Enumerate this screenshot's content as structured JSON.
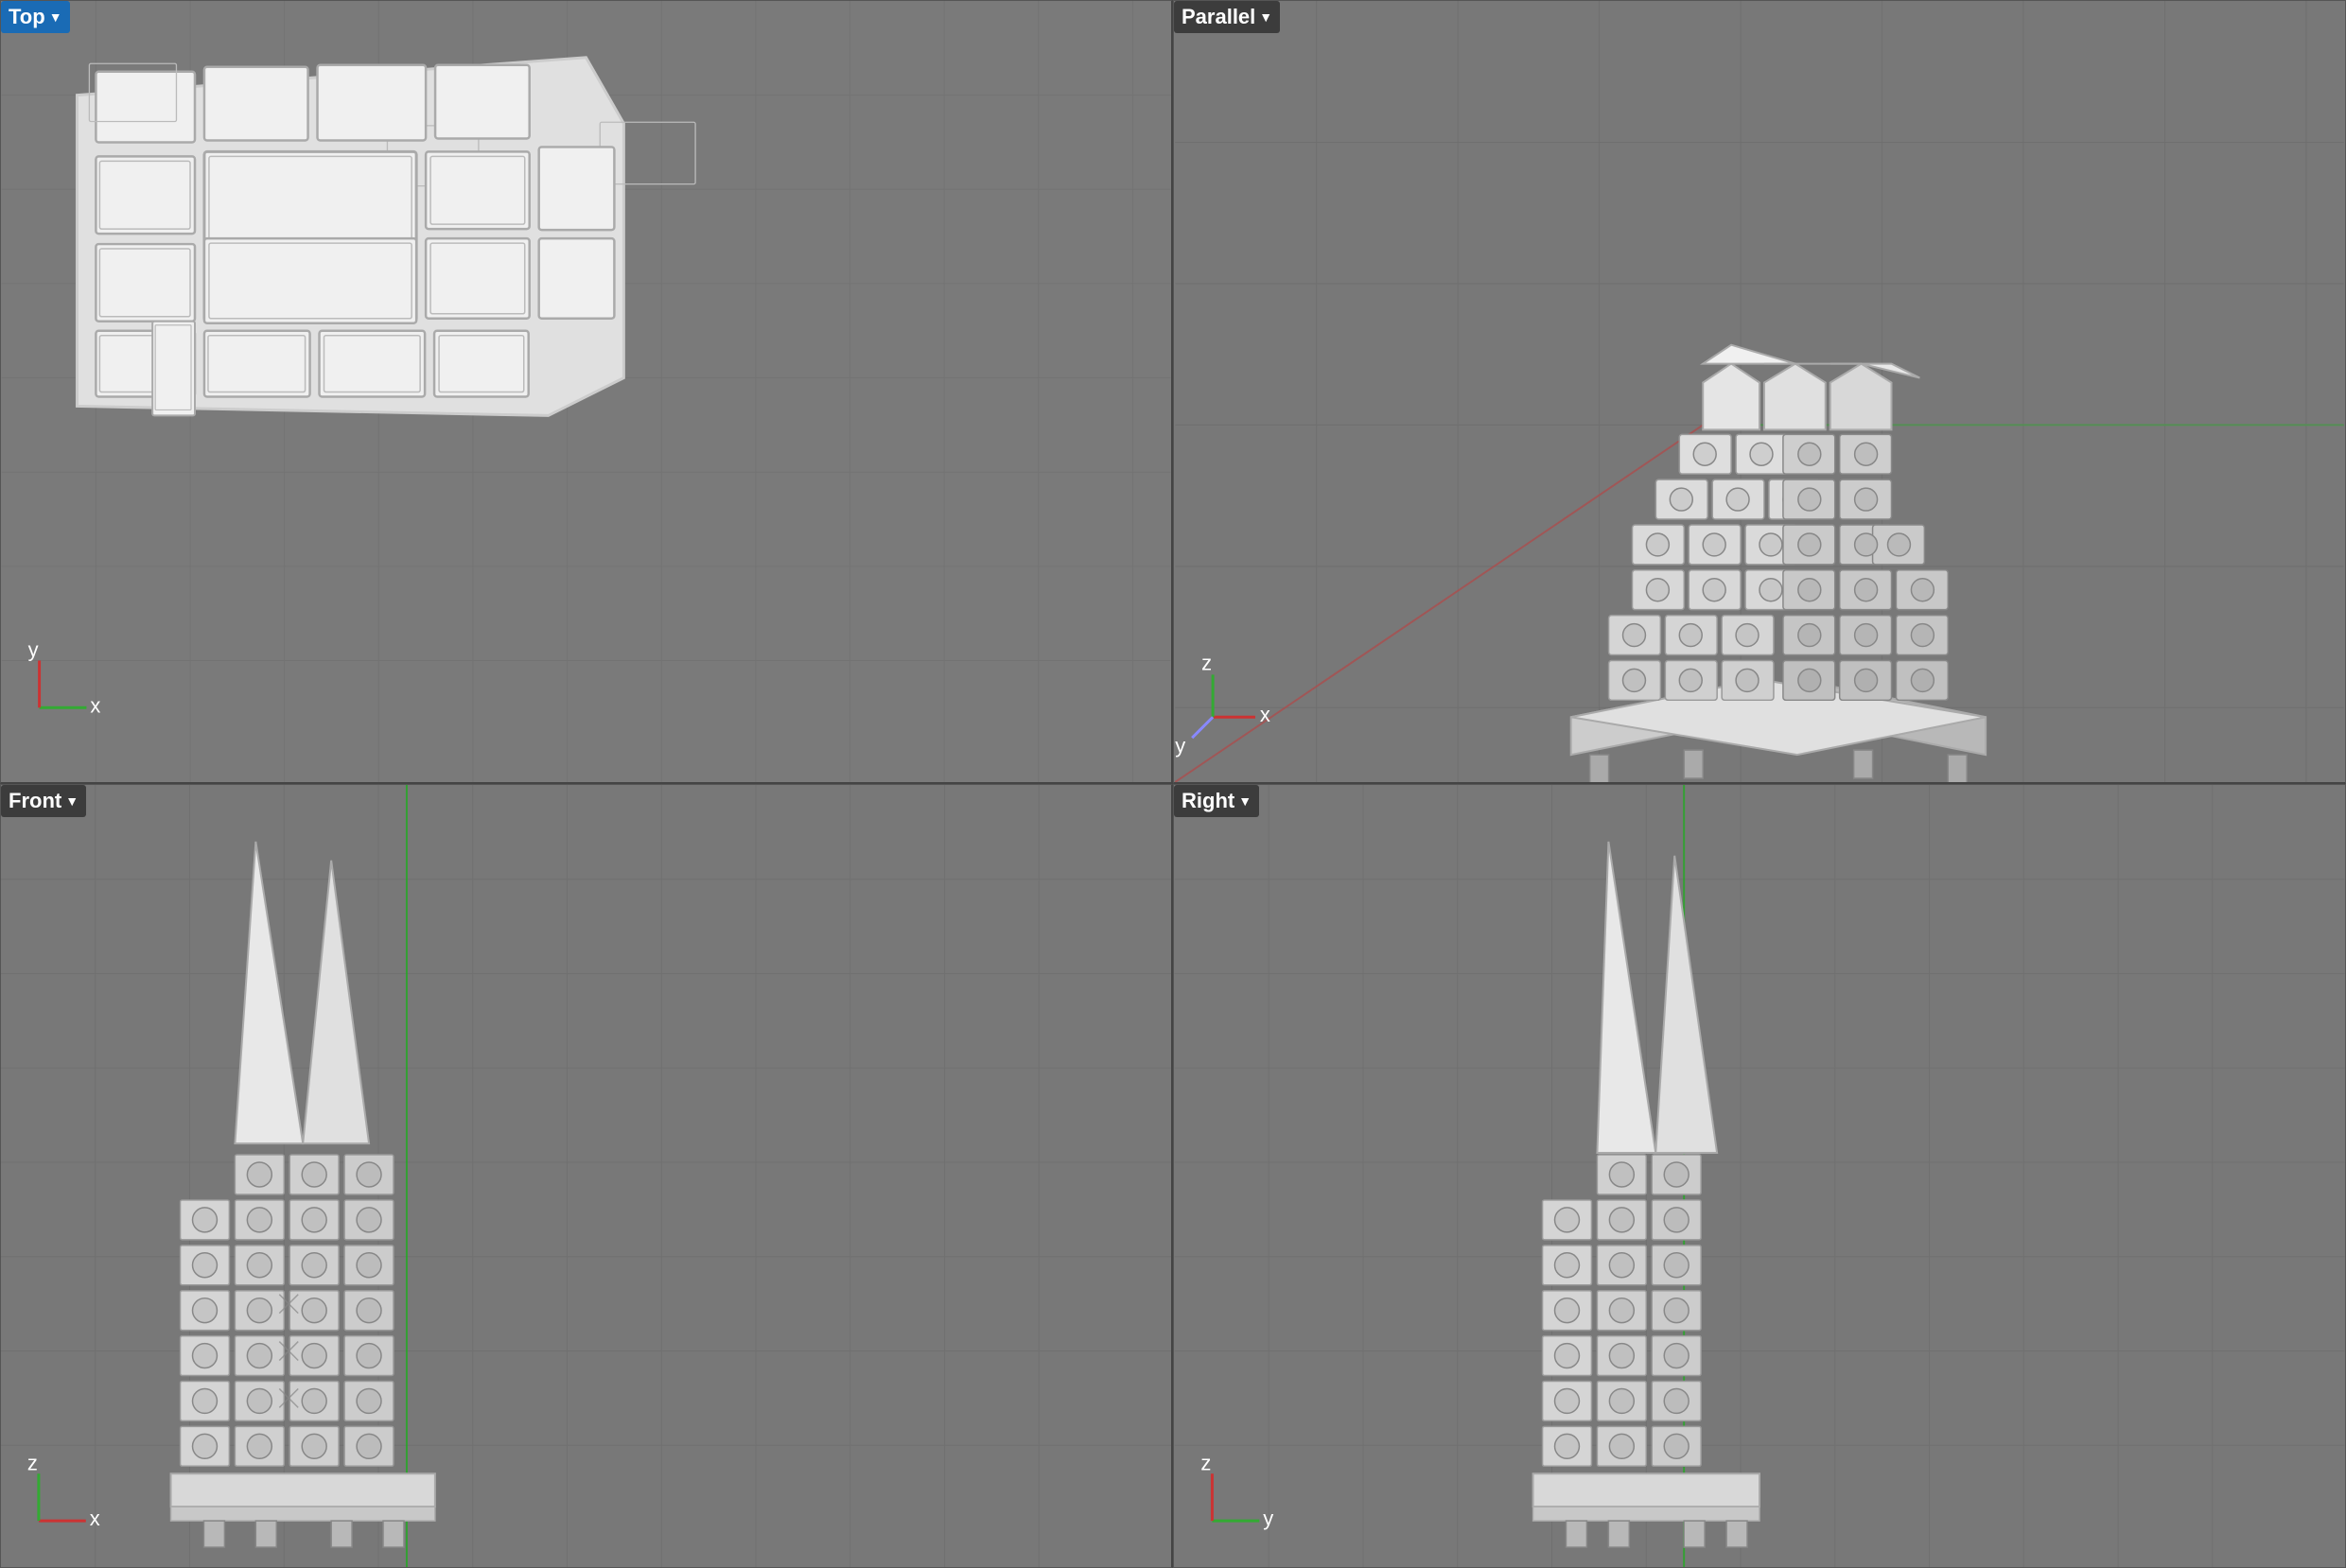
{
  "viewports": [
    {
      "id": "top",
      "label": "Top",
      "label_style": "blue-bg",
      "has_dropdown": true,
      "axis": {
        "labels": [
          "y",
          "x"
        ],
        "positions": "bottom-left"
      },
      "view_type": "orthographic"
    },
    {
      "id": "parallel",
      "label": "Parallel",
      "label_style": "dark-bg",
      "has_dropdown": true,
      "axis": {
        "labels": [
          "x",
          "z",
          "y"
        ],
        "positions": "bottom-left"
      },
      "view_type": "isometric"
    },
    {
      "id": "front",
      "label": "Front",
      "label_style": "dark-bg",
      "has_dropdown": true,
      "axis": {
        "labels": [
          "z",
          "x"
        ],
        "positions": "bottom-left"
      },
      "view_type": "orthographic"
    },
    {
      "id": "right",
      "label": "Right",
      "label_style": "dark-bg",
      "has_dropdown": true,
      "axis": {
        "labels": [
          "z",
          "y"
        ],
        "positions": "bottom-left"
      },
      "view_type": "orthographic"
    }
  ],
  "colors": {
    "background": "#7a7a7a",
    "grid_line": "#888888",
    "grid_line_major": "#6a6a6a",
    "model_stroke": "#ffffff",
    "model_fill": "#f0f0f0",
    "axis_x": "#cc3333",
    "axis_y": "#33aa33",
    "axis_z": "#3333cc",
    "label_blue": "#1a6bb5",
    "viewport_border": "#444444"
  }
}
